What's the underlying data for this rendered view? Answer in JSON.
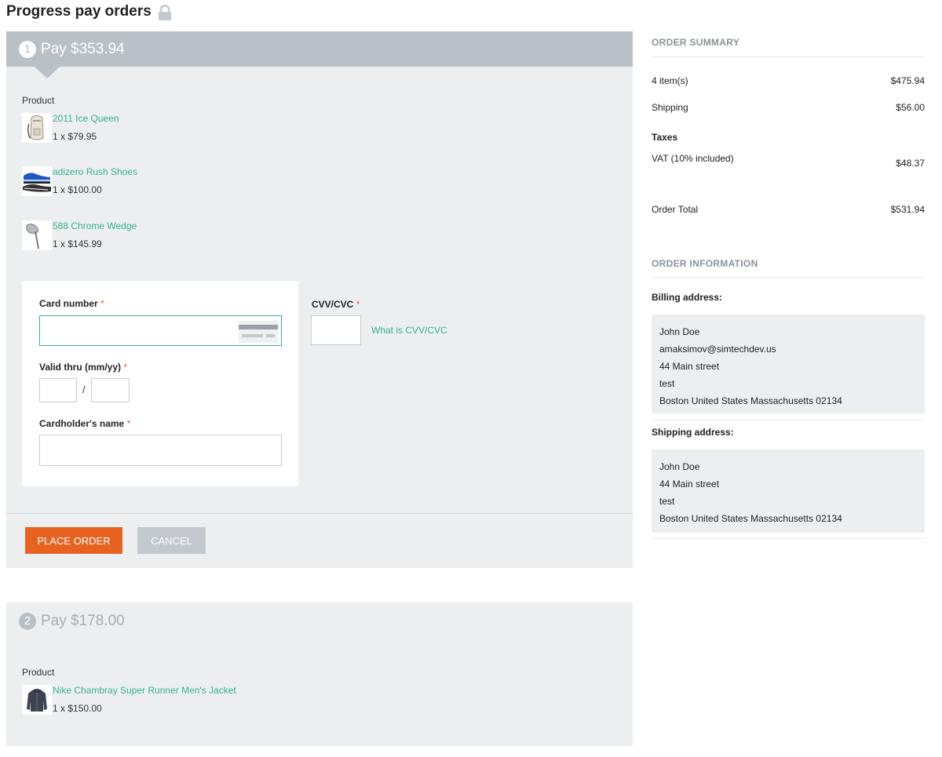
{
  "page": {
    "title": "Progress pay orders",
    "title_icon": "lock-icon"
  },
  "steps": [
    {
      "number": "1",
      "title": "Pay $353.94",
      "product_label": "Product",
      "products": [
        {
          "name": "2011 Ice Queen",
          "qty_price": "1 x $79.95",
          "thumb": "backpack"
        },
        {
          "name": "adizero Rush Shoes",
          "qty_price": "1 x $100.00",
          "thumb": "shoes"
        },
        {
          "name": "588 Chrome Wedge",
          "qty_price": "1 x $145.99",
          "thumb": "golf-club"
        }
      ],
      "form": {
        "card_number_label": "Card number",
        "valid_thru_label": "Valid thru (mm/yy)",
        "cardholder_label": "Cardholder's name",
        "cvv_label": "CVV/CVC",
        "cvv_link": "What is CVV/CVC",
        "required_mark": "*",
        "date_separator": "/"
      },
      "buttons": {
        "place_order": "PLACE ORDER",
        "cancel": "CANCEL"
      }
    },
    {
      "number": "2",
      "title": "Pay $178.00",
      "product_label": "Product",
      "products": [
        {
          "name": "Nike Chambray Super Runner Men's Jacket",
          "qty_price": "1 x $150.00",
          "thumb": "jacket"
        }
      ]
    }
  ],
  "summary": {
    "title": "ORDER SUMMARY",
    "items_label": "4 item(s)",
    "items_value": "$475.94",
    "shipping_label": "Shipping",
    "shipping_value": "$56.00",
    "taxes_label": "Taxes",
    "vat_label": "VAT (10% included)",
    "vat_value": "$48.37",
    "total_label": "Order Total",
    "total_value": "$531.94"
  },
  "info": {
    "title": "ORDER INFORMATION",
    "billing_label": "Billing address:",
    "billing": [
      "John Doe",
      "amaksimov@simtechdev.us",
      "44 Main street",
      "test",
      "Boston United States Massachusetts 02134"
    ],
    "shipping_label": "Shipping address:",
    "shipping": [
      "John Doe",
      "44 Main street",
      "test",
      "Boston United States Massachusetts 02134"
    ]
  },
  "colors": {
    "accent": "#35b48c",
    "primary_button": "#e8621f",
    "step_header": "#b9c0c6"
  }
}
